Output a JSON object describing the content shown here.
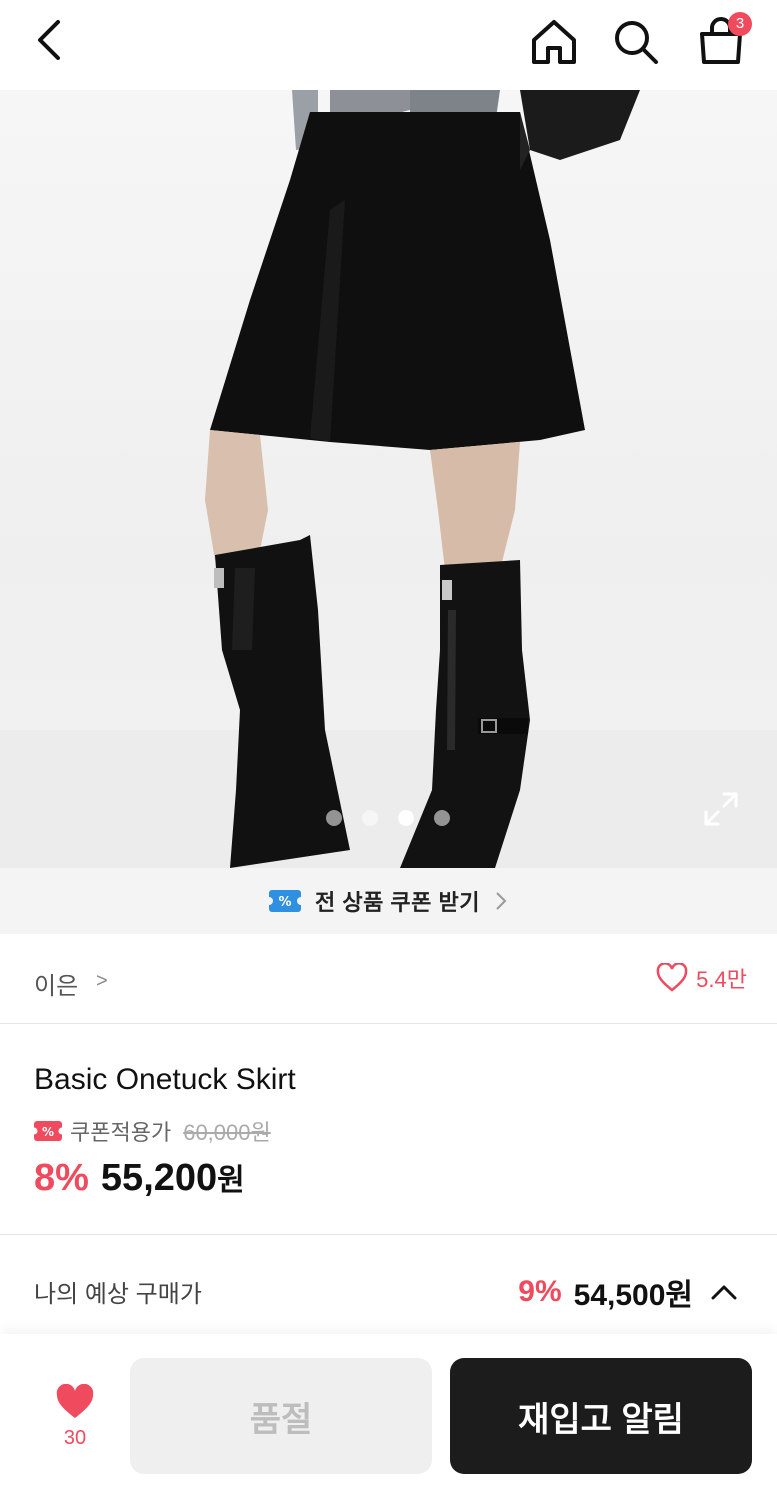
{
  "header": {
    "cart_badge": "3"
  },
  "gallery": {
    "total_dots": 4,
    "active_index": 2
  },
  "coupon_banner": {
    "label": "전 상품 쿠폰 받기"
  },
  "brand": {
    "name": "이은",
    "chevron": ">",
    "likes": "5.4만"
  },
  "product": {
    "title": "Basic Onetuck Skirt",
    "coupon_label": "쿠폰적용가",
    "original_price": "60,000원",
    "discount": "8%",
    "price": "55,200",
    "currency": "원"
  },
  "expected_price": {
    "label": "나의 예상 구매가",
    "discount": "9%",
    "price": "54,500원"
  },
  "bottom_bar": {
    "wish_count": "30",
    "soldout_label": "품절",
    "restock_label": "재입고 알림"
  },
  "colors": {
    "accent": "#ef4a5e",
    "dark_button": "#1c1c1c",
    "coupon_blue": "#2f8fe0"
  }
}
